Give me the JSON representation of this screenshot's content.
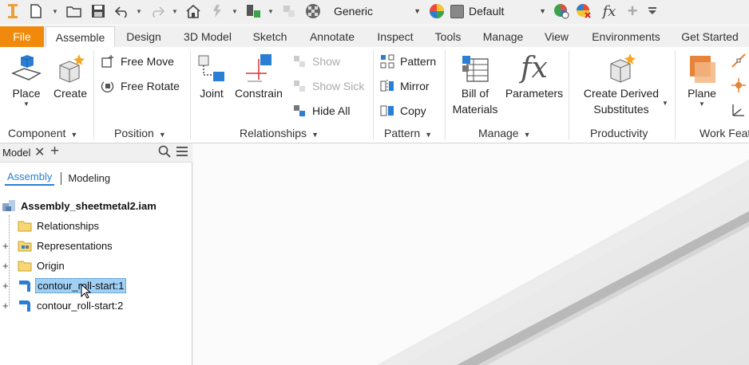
{
  "toolbar": {
    "appearance_combo": "Generic",
    "material_combo": "Default",
    "fx_icon_label": "fx"
  },
  "tabs": [
    "File",
    "Assemble",
    "Design",
    "3D Model",
    "Sketch",
    "Annotate",
    "Inspect",
    "Tools",
    "Manage",
    "View",
    "Environments",
    "Get Started"
  ],
  "ribbon": {
    "component": {
      "label": "Component",
      "place": "Place",
      "create": "Create"
    },
    "position": {
      "label": "Position",
      "free_move": "Free Move",
      "free_rotate": "Free Rotate"
    },
    "relationships": {
      "label": "Relationships",
      "joint": "Joint",
      "constrain": "Constrain",
      "show": "Show",
      "show_sick": "Show Sick",
      "hide_all": "Hide All"
    },
    "pattern": {
      "label": "Pattern",
      "pattern": "Pattern",
      "mirror": "Mirror",
      "copy": "Copy"
    },
    "manage": {
      "label": "Manage",
      "bom_line1": "Bill of",
      "bom_line2": "Materials",
      "parameters": "Parameters",
      "fx": "fx"
    },
    "productivity": {
      "label": "Productivity",
      "derived_line1": "Create Derived",
      "derived_line2": "Substitutes"
    },
    "work_features": {
      "label": "Work Feat",
      "plane": "Plane"
    }
  },
  "browser": {
    "title": "Model",
    "subtab_assembly": "Assembly",
    "subtab_modeling": "Modeling",
    "root": "Assembly_sheetmetal2.iam",
    "items": [
      "Relationships",
      "Representations",
      "Origin",
      "contour_roll-start:1",
      "contour_roll-start:2"
    ]
  },
  "colors": {
    "file_tab": "#f0890c",
    "selection": "#9fd0f5",
    "accent_blue": "#2a7fd4",
    "accent_orange": "#e8843a"
  }
}
